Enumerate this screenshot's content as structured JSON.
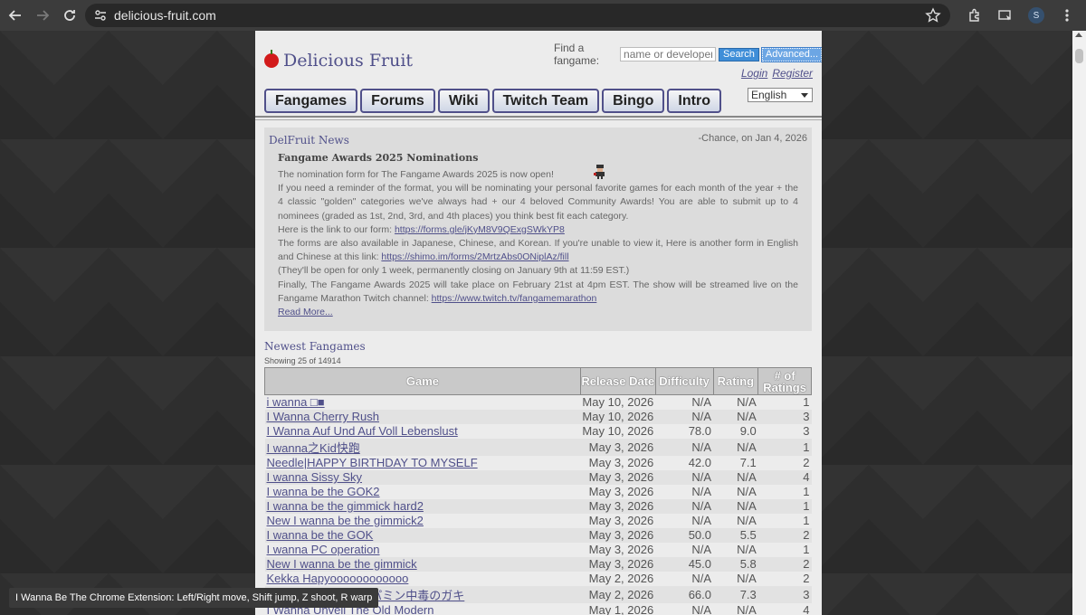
{
  "browser": {
    "url": "delicious-fruit.com",
    "avatar_letter": "S"
  },
  "site": {
    "logo_text": "Delicious Fruit",
    "search_label": "Find a fangame:",
    "search_placeholder": "name or developer",
    "search_button": "Search",
    "advanced_button": "Advanced...",
    "login": "Login",
    "register": "Register",
    "language": "English"
  },
  "tabs": [
    "Fangames",
    "Forums",
    "Wiki",
    "Twitch Team",
    "Bingo",
    "Intro"
  ],
  "news": {
    "title": "DelFruit News",
    "meta": "-Chance, on Jan 4, 2026",
    "headline": "Fangame Awards 2025 Nominations",
    "p1": "The nomination form for The Fangame Awards 2025 is now open!",
    "p2": "If you need a reminder of the format, you will be nominating your personal favorite games for each month of the year + the 4 classic \"golden\" categories we've always had + our 4 beloved Community Awards! You are able to submit up to 4 nominees (graded as 1st, 2nd, 3rd, and 4th places) you think best fit each category.",
    "p3_pre": "Here is the link to our form: ",
    "p3_link": "https://forms.gle/jKyM8V9QExgSWkYP8",
    "p4_pre": "The forms are also available in Japanese, Chinese, and Korean. If you're unable to view it, Here is another form in English and Chinese at this link: ",
    "p4_link": "https://shimo.im/forms/2MrtzAbs0ONiplAz/fill",
    "p5": "(They'll be open for only 1 week, permanently closing on January 9th at 11:59 EST.)",
    "p6_pre": "Finally, The Fangame Awards 2025 will take place on February 21st at 4pm EST. The show will be streamed live on the Fangame Marathon Twitch channel: ",
    "p6_link": "https://www.twitch.tv/fangamemarathon",
    "read_more": "Read More..."
  },
  "newest": {
    "title": "Newest Fangames",
    "showing": "Showing 25 of 14914",
    "headers": [
      "Game",
      "Release Date",
      "Difficulty",
      "Rating",
      "# of Ratings"
    ],
    "rows": [
      [
        "i wanna □■",
        "May 10, 2026",
        "N/A",
        "N/A",
        "1"
      ],
      [
        "I Wanna Cherry Rush",
        "May 10, 2026",
        "N/A",
        "N/A",
        "3"
      ],
      [
        "I Wanna Auf Und Auf Voll Lebenslust",
        "May 10, 2026",
        "78.0",
        "9.0",
        "3"
      ],
      [
        "I wanna之Kid快跑",
        "May 3, 2026",
        "N/A",
        "N/A",
        "1"
      ],
      [
        "Needle|HAPPY BIRTHDAY TO MYSELF",
        "May 3, 2026",
        "42.0",
        "7.1",
        "2"
      ],
      [
        "I wanna Sissy Sky",
        "May 3, 2026",
        "N/A",
        "N/A",
        "4"
      ],
      [
        "I wanna be the GOK2",
        "May 3, 2026",
        "N/A",
        "N/A",
        "1"
      ],
      [
        "I wanna be the gimmick hard2",
        "May 3, 2026",
        "N/A",
        "N/A",
        "1"
      ],
      [
        "New I wanna be the gimmick2",
        "May 3, 2026",
        "N/A",
        "N/A",
        "1"
      ],
      [
        "I wanna be the GOK",
        "May 3, 2026",
        "50.0",
        "5.5",
        "2"
      ],
      [
        "I wanna PC operation",
        "May 3, 2026",
        "N/A",
        "N/A",
        "1"
      ],
      [
        "New I wanna be the gimmick",
        "May 3, 2026",
        "45.0",
        "5.8",
        "2"
      ],
      [
        "Kekka Hapyoooooooooooo",
        "May 2, 2026",
        "N/A",
        "N/A",
        "2"
      ],
      [
        "I wanna be the ドーパミン中毒のガキ",
        "May 2, 2026",
        "66.0",
        "7.3",
        "3"
      ],
      [
        "I Wanna Unveil The Old Modern",
        "May 1, 2026",
        "N/A",
        "N/A",
        "4"
      ]
    ]
  },
  "toast": "I Wanna Be The Chrome Extension: Left/Right move, Shift jump, Z shoot, R warp"
}
